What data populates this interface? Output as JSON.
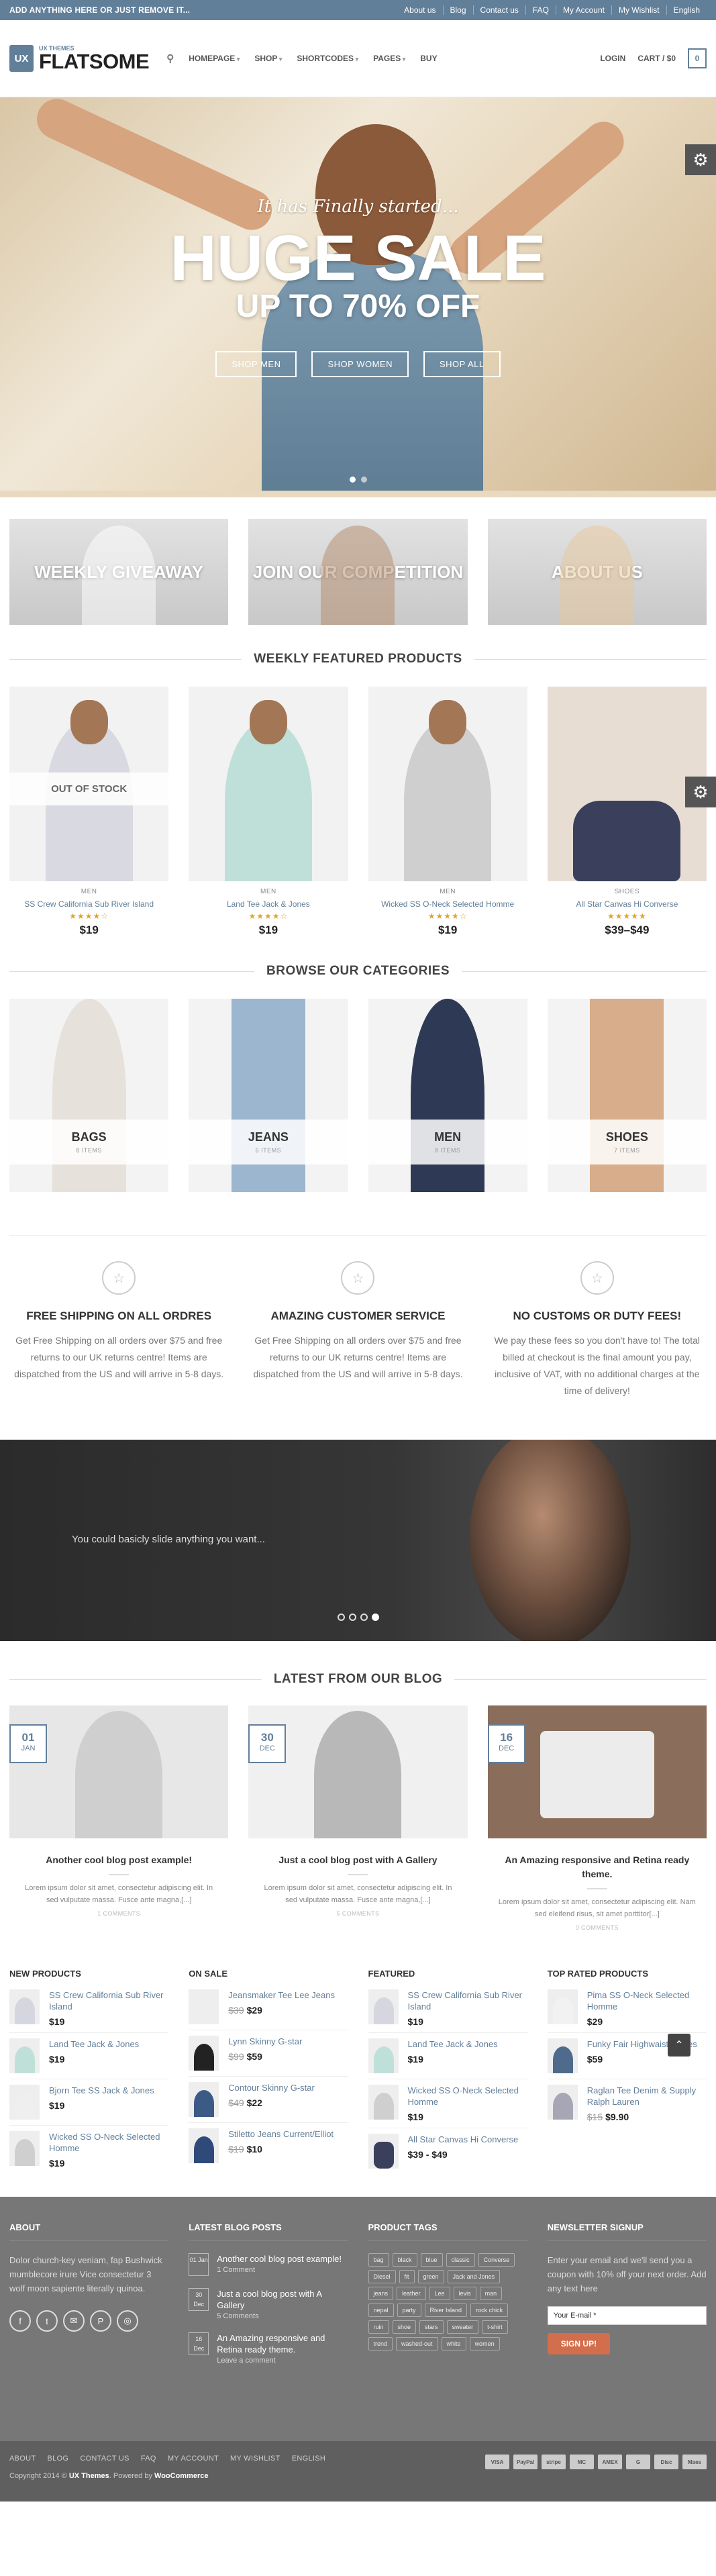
{
  "topbar": {
    "announcement": "ADD ANYTHING HERE OR JUST REMOVE IT...",
    "links": [
      "About us",
      "Blog",
      "Contact us",
      "FAQ",
      "My Account",
      "My Wishlist",
      "English"
    ]
  },
  "header": {
    "logo_badge": "UX",
    "logo_sub": "UX THEMES",
    "logo_title": "FLATSOME",
    "nav": [
      "HOMEPAGE",
      "SHOP",
      "SHORTCODES",
      "PAGES",
      "BUY"
    ],
    "login": "LOGIN",
    "cart_label": "CART / $0",
    "cart_count": "0"
  },
  "hero": {
    "tagline": "It has Finally started...",
    "headline": "HUGE SALE",
    "subheadline": "UP TO 70% OFF",
    "buttons": [
      "SHOP MEN",
      "SHOP WOMEN",
      "SHOP ALL"
    ]
  },
  "promos": [
    {
      "title": "WEEKLY GIVEAWAY"
    },
    {
      "title": "JOIN OUR COMPETITION"
    },
    {
      "title": "ABOUT US"
    }
  ],
  "featured": {
    "title": "WEEKLY FEATURED PRODUCTS",
    "out_of_stock": "OUT OF STOCK",
    "items": [
      {
        "cat": "MEN",
        "name": "SS Crew California Sub River Island",
        "stars": "★★★★☆",
        "price": "$19"
      },
      {
        "cat": "MEN",
        "name": "Land Tee Jack & Jones",
        "stars": "★★★★☆",
        "price": "$19"
      },
      {
        "cat": "MEN",
        "name": "Wicked SS O-Neck Selected Homme",
        "stars": "★★★★☆",
        "price": "$19"
      },
      {
        "cat": "SHOES",
        "name": "All Star Canvas Hi Converse",
        "stars": "★★★★★",
        "price": "$39–$49"
      }
    ]
  },
  "categories": {
    "title": "BROWSE OUR CATEGORIES",
    "items": [
      {
        "name": "BAGS",
        "count": "8 ITEMS"
      },
      {
        "name": "JEANS",
        "count": "6 ITEMS"
      },
      {
        "name": "MEN",
        "count": "8 ITEMS"
      },
      {
        "name": "SHOES",
        "count": "7 ITEMS"
      }
    ]
  },
  "features": [
    {
      "title": "FREE SHIPPING ON ALL ORDRES",
      "text": "Get Free Shipping on all orders over $75 and free returns to our UK returns centre! Items are dispatched from the US and will arrive in 5-8 days."
    },
    {
      "title": "AMAZING CUSTOMER SERVICE",
      "text": "Get Free Shipping on all orders over $75 and free returns to our UK returns centre! Items are dispatched from the US and will arrive in 5-8 days."
    },
    {
      "title": "NO CUSTOMS OR DUTY FEES!",
      "text": "We pay these fees so you don't have to! The total billed at checkout is the final amount you pay, inclusive of VAT, with no additional charges at the time of delivery!"
    }
  ],
  "slider": {
    "text": "You could basicly slide anything you want..."
  },
  "blog": {
    "title": "LATEST FROM OUR BLOG",
    "posts": [
      {
        "day": "01",
        "month": "JAN",
        "title": "Another cool blog post example!",
        "excerpt": "Lorem ipsum dolor sit amet, consectetur adipiscing elit. In sed vulputate massa. Fusce ante magna,[...]",
        "comments": "1 COMMENTS"
      },
      {
        "day": "30",
        "month": "DEC",
        "title": "Just a cool blog post with A Gallery",
        "excerpt": "Lorem ipsum dolor sit amet, consectetur adipiscing elit. In sed vulputate massa. Fusce ante magna,[...]",
        "comments": "5 COMMENTS"
      },
      {
        "day": "16",
        "month": "DEC",
        "title": "An Amazing responsive and Retina ready theme.",
        "excerpt": "Lorem ipsum dolor sit amet, consectetur adipiscing elit. Nam sed eleifend risus, sit amet porttitor[...]",
        "comments": "0 COMMENTS"
      }
    ]
  },
  "lists": [
    {
      "title": "NEW PRODUCTS",
      "items": [
        {
          "name": "SS Crew California Sub River Island",
          "price": "$19",
          "old": ""
        },
        {
          "name": "Land Tee Jack & Jones",
          "price": "$19",
          "old": ""
        },
        {
          "name": "Bjorn Tee SS Jack & Jones",
          "price": "$19",
          "old": ""
        },
        {
          "name": "Wicked SS O-Neck Selected Homme",
          "price": "$19",
          "old": ""
        }
      ]
    },
    {
      "title": "ON SALE",
      "items": [
        {
          "name": "Jeansmaker Tee Lee Jeans",
          "price": "$29",
          "old": "$39"
        },
        {
          "name": "Lynn Skinny G-star",
          "price": "$59",
          "old": "$99"
        },
        {
          "name": "Contour Skinny G-star",
          "price": "$22",
          "old": "$49"
        },
        {
          "name": "Stiletto Jeans Current/Elliot",
          "price": "$10",
          "old": "$19"
        }
      ]
    },
    {
      "title": "FEATURED",
      "items": [
        {
          "name": "SS Crew California Sub River Island",
          "price": "$19",
          "old": ""
        },
        {
          "name": "Land Tee Jack & Jones",
          "price": "$19",
          "old": ""
        },
        {
          "name": "Wicked SS O-Neck Selected Homme",
          "price": "$19",
          "old": ""
        },
        {
          "name": "All Star Canvas Hi Converse",
          "price": "$39 - $49",
          "old": ""
        }
      ]
    },
    {
      "title": "TOP RATED PRODUCTS",
      "items": [
        {
          "name": "Pima SS O-Neck Selected Homme",
          "price": "$29",
          "old": ""
        },
        {
          "name": "Funky Fair Highwaist Pieces",
          "price": "$59",
          "old": ""
        },
        {
          "name": "Raglan Tee Denim & Supply Ralph Lauren",
          "price": "$9.90",
          "old": "$15"
        }
      ]
    }
  ],
  "footer": {
    "about_title": "ABOUT",
    "about_text": "Dolor church-key veniam, fap Bushwick mumblecore irure Vice consectetur 3 wolf moon sapiente literally quinoa.",
    "social": [
      "f",
      "t",
      "✉",
      "P",
      "◎"
    ],
    "posts_title": "LATEST BLOG POSTS",
    "posts": [
      {
        "date": "01 Jan",
        "title": "Another cool blog post example!",
        "comments": "1 Comment"
      },
      {
        "date": "30 Dec",
        "title": "Just a cool blog post with A Gallery",
        "comments": "5 Comments"
      },
      {
        "date": "16 Dec",
        "title": "An Amazing responsive and Retina ready theme.",
        "comments": "Leave a comment"
      }
    ],
    "tags_title": "PRODUCT TAGS",
    "tags": [
      "bag",
      "black",
      "blue",
      "classic",
      "Converse",
      "Diesel",
      "fit",
      "green",
      "Jack and Jones",
      "jeans",
      "leather",
      "Lee",
      "levis",
      "man",
      "nepal",
      "party",
      "River Island",
      "rock chick",
      "ruin",
      "shoe",
      "stars",
      "sweater",
      "t-shirt",
      "trend",
      "washed-out",
      "white",
      "women"
    ],
    "newsletter_title": "NEWSLETTER SIGNUP",
    "newsletter_text": "Enter your email and we'll send you a coupon with 10% off your next order. Add any text here",
    "email_placeholder": "Your E-mail *",
    "signup_label": "SIGN UP!"
  },
  "bottom": {
    "links": [
      "ABOUT",
      "BLOG",
      "CONTACT US",
      "FAQ",
      "MY ACCOUNT",
      "MY WISHLIST",
      "ENGLISH"
    ],
    "copyright_pre": "Copyright 2014 ©",
    "brand": "UX Themes",
    "powered_pre": ". Powered by",
    "powered": "WooCommerce",
    "payments": [
      "VISA",
      "PayPal",
      "stripe",
      "MC",
      "AMEX",
      "G",
      "Disc",
      "Maes"
    ]
  },
  "colors": {
    "accent": "#627f9a",
    "button": "#d26e4b",
    "star": "#e2a324"
  }
}
